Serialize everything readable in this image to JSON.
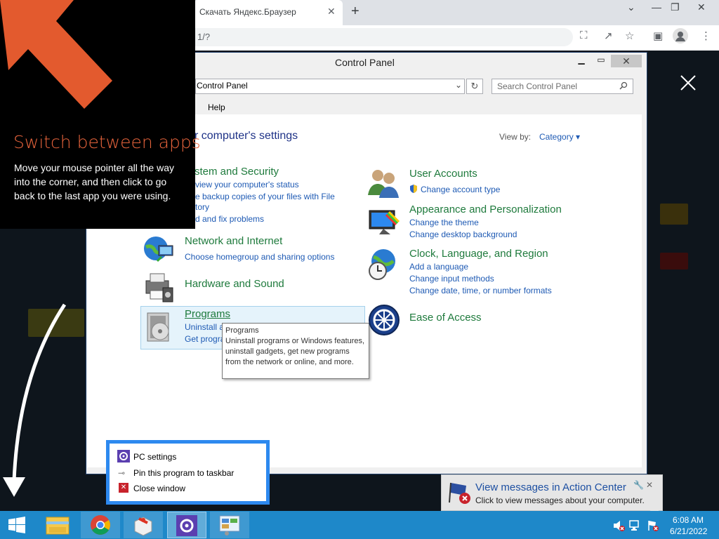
{
  "browser": {
    "tab_title": "Скачать Яндекс.Браузер",
    "tab_close": "✕",
    "new_tab": "+",
    "url": "1/?",
    "win_minimize": "⌄",
    "win_restore": "—",
    "win_max": "❐",
    "win_close": "✕"
  },
  "switch_tip": {
    "title": "Switch between apps",
    "body": "Move your mouse pointer all the way into the corner, and then click to go back to the last app you were using."
  },
  "control_panel": {
    "window_title": "Control Panel",
    "address": "Control Panel",
    "search_placeholder": "Search Control Panel",
    "menu_help": "Help",
    "heading": "r computer's settings",
    "view_by_label": "View by:",
    "view_by_value": "Category ▾",
    "categories": {
      "system": {
        "title": "stem and Security",
        "links": [
          "view your computer's status",
          "e backup copies of your files with File",
          "tory",
          "d and fix problems"
        ]
      },
      "network": {
        "title": "Network and Internet",
        "links": [
          "Choose homegroup and sharing options"
        ]
      },
      "hardware": {
        "title": "Hardware and Sound"
      },
      "programs": {
        "title": "Programs",
        "links": [
          "Uninstall a",
          "Get progra"
        ]
      },
      "user_accounts": {
        "title": "User Accounts",
        "links": [
          "Change account type"
        ]
      },
      "appearance": {
        "title": "Appearance and Personalization",
        "links": [
          "Change the theme",
          "Change desktop background"
        ]
      },
      "clock": {
        "title": "Clock, Language, and Region",
        "links": [
          "Add a language",
          "Change input methods",
          "Change date, time, or number formats"
        ]
      },
      "ease": {
        "title": "Ease of Access"
      }
    },
    "tooltip": {
      "title": "Programs",
      "body": "Uninstall programs or Windows features, uninstall gadgets, get new programs from the network or online, and more."
    }
  },
  "jumplist": {
    "items": [
      "PC settings",
      "Pin this program to taskbar",
      "Close window"
    ]
  },
  "toast": {
    "title": "View messages in Action Center",
    "body": "Click to view messages about your computer.",
    "close": "✕"
  },
  "taskbar": {
    "time": "6:08 AM",
    "date": "6/21/2022"
  },
  "colors": {
    "accent_orange": "#e8643c",
    "taskbar_blue": "#1e88c9",
    "link_blue": "#1e5ab4",
    "category_green": "#1e7a3c"
  }
}
